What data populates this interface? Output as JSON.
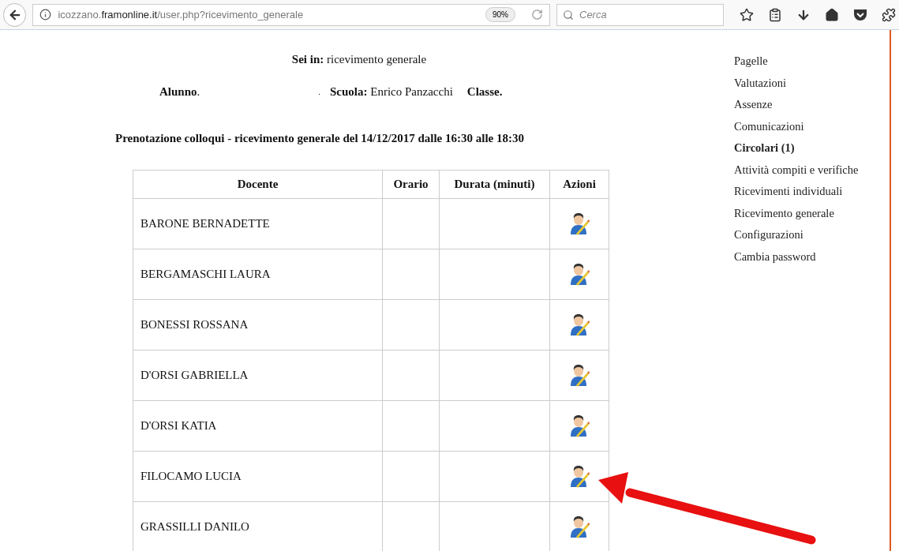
{
  "browser": {
    "url": "icozzano.**framonline.it**/user.php?ricevimento_generale",
    "zoom": "90%",
    "search": {
      "placeholder": "Cerca"
    }
  },
  "breadcrumb": "**Sei in:** ricevimento generale",
  "student": {
    "alunno": "**Alunno**.",
    "mark": ".",
    "scuola": "**Scuola:** Enrico Panzacchi",
    "classe": "Classe."
  },
  "heading": "Prenotazione colloqui - ricevimento generale del 14/12/2017 dalle 16:30 alle 18:30",
  "table": {
    "columns": [
      "Docente",
      "Orario",
      "Durata (minuti)",
      "Azioni"
    ],
    "rows": [
      {
        "docente": "BARONE BERNADETTE"
      },
      {
        "docente": "BERGAMASCHI LAURA"
      },
      {
        "docente": "BONESSI ROSSANA"
      },
      {
        "docente": "D'ORSI GABRIELLA"
      },
      {
        "docente": "D'ORSI KATIA"
      },
      {
        "docente": "FILOCAMO LUCIA"
      },
      {
        "docente": "GRASSILLI DANILO"
      }
    ]
  },
  "sidebar": {
    "items": [
      {
        "label": "Pagelle",
        "bold": false
      },
      {
        "label": "Valutazioni",
        "bold": false
      },
      {
        "label": "Assenze",
        "bold": false
      },
      {
        "label": "Comunicazioni",
        "bold": false
      },
      {
        "label": "Circolari (1)",
        "bold": true
      },
      {
        "label": "Attività compiti e verifiche",
        "bold": false
      },
      {
        "label": "Ricevimenti individuali",
        "bold": false
      },
      {
        "label": "Ricevimento generale",
        "bold": false
      },
      {
        "label": "Configurazioni",
        "bold": false
      },
      {
        "label": "Cambia password",
        "bold": false
      }
    ]
  }
}
